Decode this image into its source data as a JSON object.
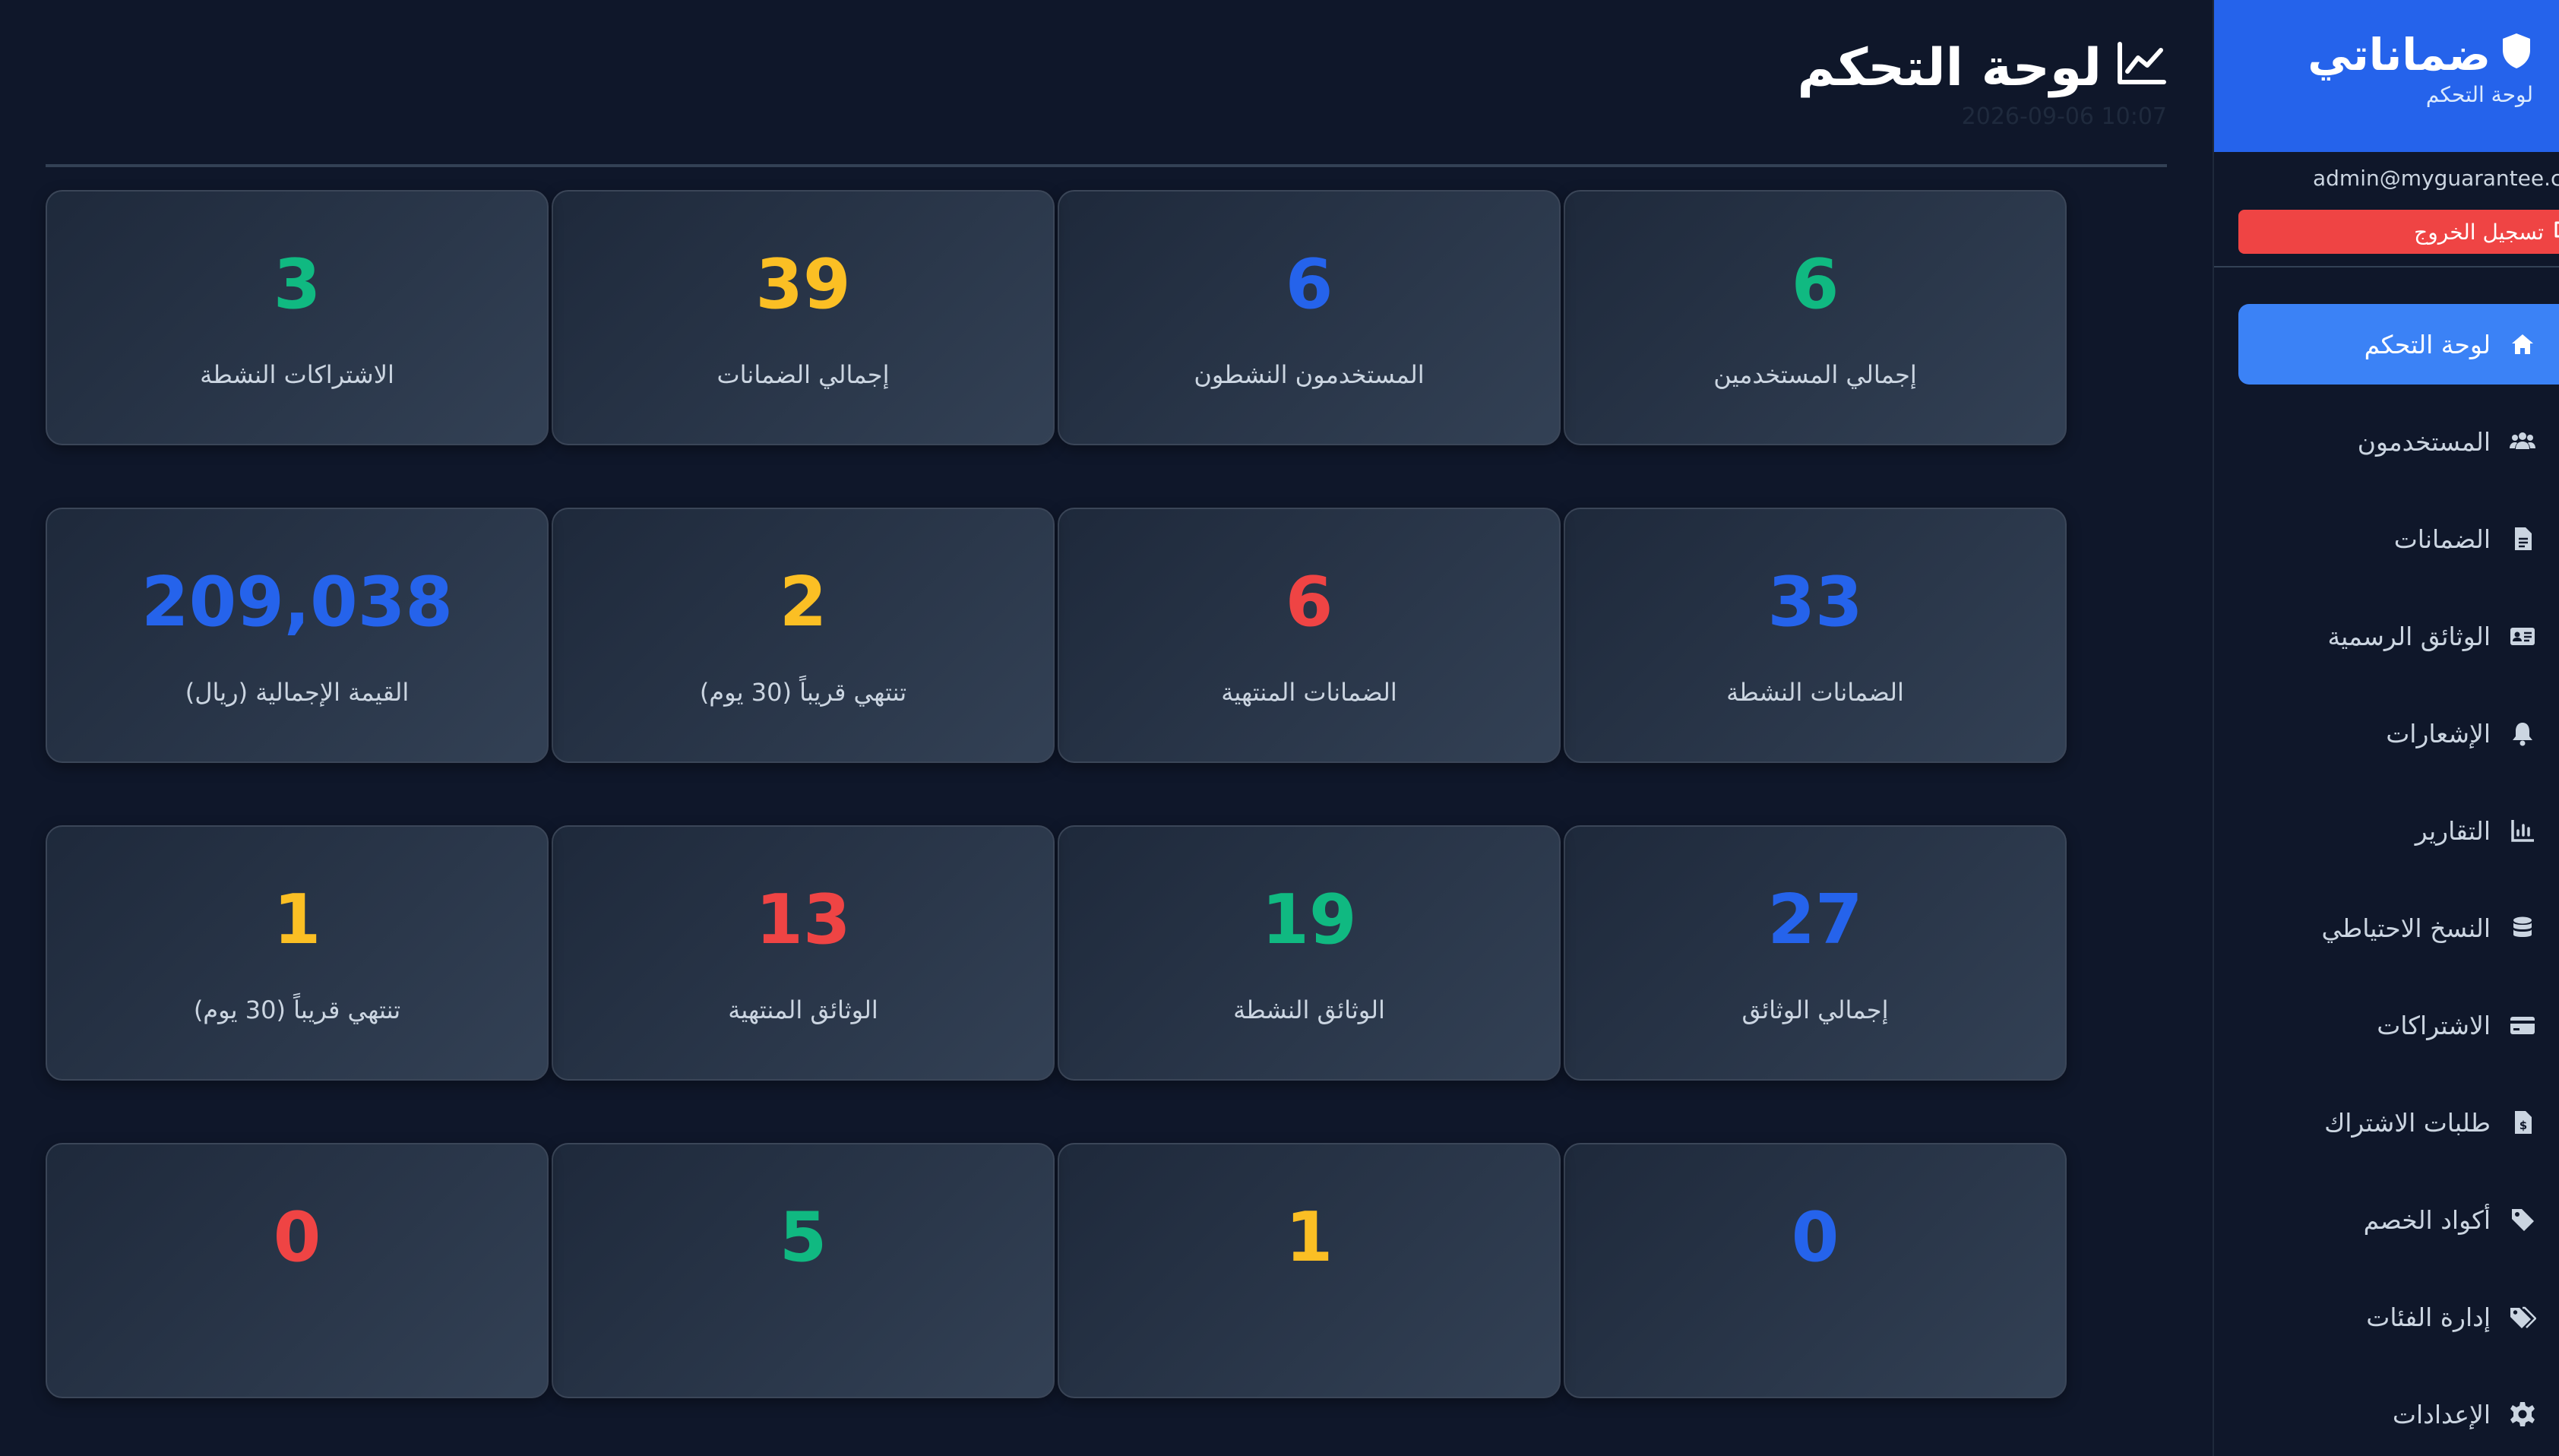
{
  "app": {
    "brand": "ضماناتي",
    "brand_sub": "لوحة التحكم"
  },
  "user": {
    "email": "admin@myguarantee.com",
    "logout_label": "تسجيل الخروج"
  },
  "nav": [
    {
      "label": "لوحة التحكم",
      "icon": "home-icon",
      "active": true
    },
    {
      "label": "المستخدمون",
      "icon": "users-icon"
    },
    {
      "label": "الضمانات",
      "icon": "file-icon"
    },
    {
      "label": "الوثائق الرسمية",
      "icon": "id-card-icon"
    },
    {
      "label": "الإشعارات",
      "icon": "bell-icon"
    },
    {
      "label": "التقارير",
      "icon": "chart-icon"
    },
    {
      "label": "النسخ الاحتياطي",
      "icon": "database-icon"
    },
    {
      "label": "الاشتراكات",
      "icon": "credit-card-icon"
    },
    {
      "label": "طلبات الاشتراك",
      "icon": "invoice-icon"
    },
    {
      "label": "أكواد الخصم",
      "icon": "tag-icon"
    },
    {
      "label": "إدارة الفئات",
      "icon": "tags-icon"
    },
    {
      "label": "الإعدادات",
      "icon": "gear-icon"
    }
  ],
  "header": {
    "title": "لوحة التحكم",
    "timestamp": "2026-09-06 10:07"
  },
  "colors": {
    "green": "#10b981",
    "yellow": "#fbbf24",
    "blue": "#2563eb",
    "red": "#ef4444",
    "sidebar_active": "#3b82f6",
    "brand": "#2563eb"
  },
  "stats": [
    [
      {
        "value": "6",
        "label": "إجمالي المستخدمين",
        "color": "green"
      },
      {
        "value": "6",
        "label": "المستخدمون النشطون",
        "color": "blue"
      },
      {
        "value": "39",
        "label": "إجمالي الضمانات",
        "color": "yellow"
      },
      {
        "value": "3",
        "label": "الاشتراكات النشطة",
        "color": "green"
      }
    ],
    [
      {
        "value": "33",
        "label": "الضمانات النشطة",
        "color": "blue"
      },
      {
        "value": "6",
        "label": "الضمانات المنتهية",
        "color": "red"
      },
      {
        "value": "2",
        "label": "تنتهي قريباً (30 يوم)",
        "color": "yellow"
      },
      {
        "value": "209,038",
        "label": "القيمة الإجمالية (ريال)",
        "color": "blue"
      }
    ],
    [
      {
        "value": "27",
        "label": "إجمالي الوثائق",
        "color": "blue"
      },
      {
        "value": "19",
        "label": "الوثائق النشطة",
        "color": "green"
      },
      {
        "value": "13",
        "label": "الوثائق المنتهية",
        "color": "red"
      },
      {
        "value": "1",
        "label": "تنتهي قريباً (30 يوم)",
        "color": "yellow"
      }
    ],
    [
      {
        "value": "0",
        "label": "",
        "color": "blue"
      },
      {
        "value": "1",
        "label": "",
        "color": "yellow"
      },
      {
        "value": "5",
        "label": "",
        "color": "green"
      },
      {
        "value": "0",
        "label": "",
        "color": "red"
      }
    ]
  ]
}
